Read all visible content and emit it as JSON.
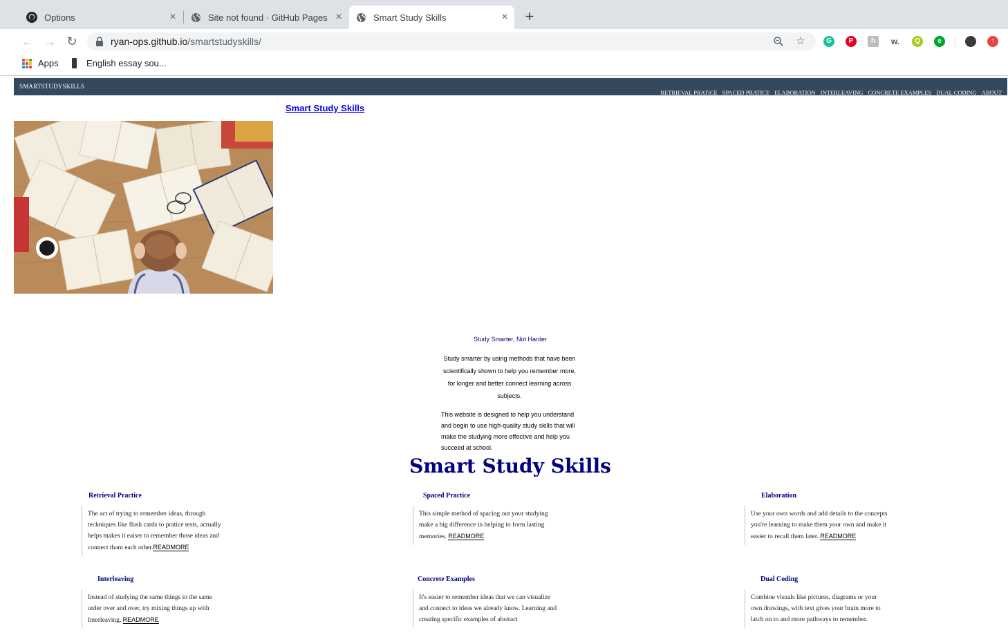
{
  "browser": {
    "tabs": [
      {
        "title": "Options",
        "icon": "github-icon"
      },
      {
        "title": "Site not found · GitHub Pages",
        "icon": "globe-icon"
      },
      {
        "title": "Smart Study Skills",
        "icon": "globe-icon",
        "active": true
      }
    ],
    "url_host": "ryan-ops.github.io",
    "url_path": "/smartstudyskills/",
    "bookmarks": [
      {
        "label": "Apps"
      },
      {
        "label": "English essay sou..."
      }
    ],
    "extension_icons": [
      "grammarly-icon",
      "pinterest-icon",
      "hypothesis-icon",
      "wikiwand-icon",
      "quip-icon",
      "evernote-icon",
      "profile-avatar",
      "upload-icon"
    ]
  },
  "site": {
    "brand": "SMARTSTUDYSKILLS",
    "nav": [
      "RETRIEVAL PRATICE",
      "SPACED PRATICE",
      "ELABORATION",
      "INTERLEAVING",
      "CONCRETE EXAMPLES",
      "DUAL CODING",
      "ABOUT"
    ],
    "hero_link": "Smart Study Skills",
    "tagline": "Study Smarter, Not Harder",
    "intro": "Study smarter by using methods that have been scientifically shown to help you remember more, for longer and better connect learning across subjects.",
    "intro2": "This website is designed to help you understand and begin to use high-quality study skills that will make the studying more effective and help you succeed at school.",
    "title": "Smart Study Skills",
    "readmore": "READMORE",
    "cards": [
      {
        "title": "Retrieval Practice",
        "text": "The act of trying to remember ideas, through techniques like flash cards to pratice tests, actually helps makes it eaiser to remember those ideas and connect tham each other."
      },
      {
        "title": "Spaced Practice",
        "text": "This simple method of spacing out your studying make a big difference in helping to form lasting memories. "
      },
      {
        "title": "Elaboration",
        "text": "Use your own words and add details to the concepts you're learning to make them your own and make it easier to recall them later. "
      },
      {
        "title": "Interleaving",
        "text": "Instead of studying the same things in the same order over and over, try mixing things up with Interleaving. "
      },
      {
        "title": "Concrete Examples",
        "text": "It's easier to remember ideas that we can visualize and connect to ideas we already know. Learning and creating specific examples of abstract"
      },
      {
        "title": "Dual Coding",
        "text": "Combine visuals like pictures, diagrams or your own drawings, with text gives your brain more to latch on to and more pathways to remember."
      }
    ]
  },
  "colors": {
    "site_bar": "#34495e",
    "title_navy": "#000080",
    "link_blue": "#0000ee",
    "tabstrip": "#dee1e6"
  }
}
